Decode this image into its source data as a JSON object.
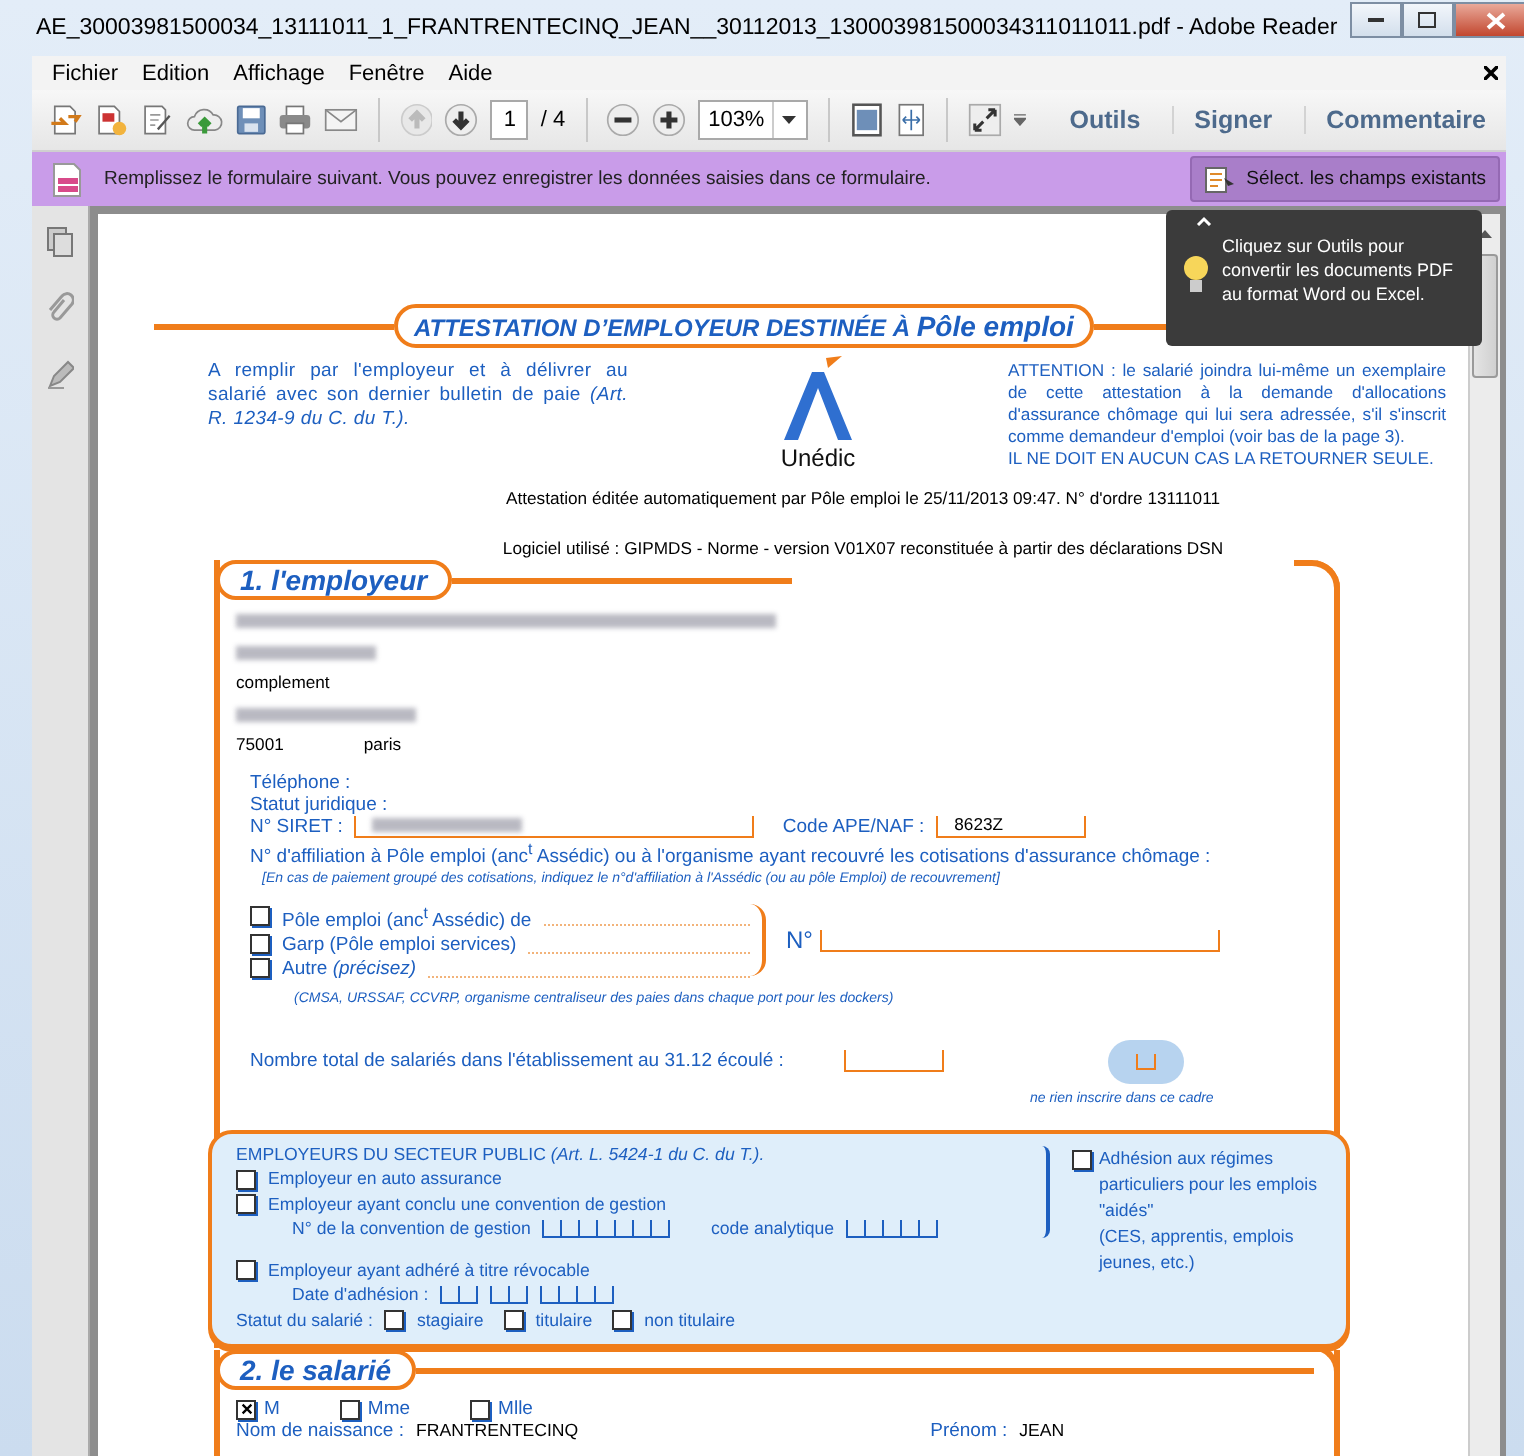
{
  "window": {
    "title": "AE_30003981500034_13111011_1_FRANTRENTECINQ_JEAN__30112013_130003981500034311011011.pdf - Adobe Reader"
  },
  "menu": [
    "Fichier",
    "Edition",
    "Affichage",
    "Fenêtre",
    "Aide"
  ],
  "toolbar": {
    "page": "1",
    "page_total": "/ 4",
    "zoom": "103%",
    "buttons": [
      "Outils",
      "Signer",
      "Commentaire"
    ]
  },
  "form_bar": {
    "message": "Remplissez le formulaire suivant. Vous pouvez enregistrer les données saisies dans ce formulaire.",
    "button": "Sélect. les champs existants"
  },
  "tooltip": {
    "text": "Cliquez sur Outils pour convertir les documents PDF au format Word ou Excel."
  },
  "document": {
    "title": "ATTESTATION D’EMPLOYEUR DESTINÉE À **Pôle emploi**",
    "intro_left": "A remplir par l'employeur et à délivrer au salarié avec son dernier bulletin de paie *(Art. R. 1234-9 du C. du T.).*",
    "logo_text": "Unédic",
    "intro_right": "ATTENTION : le salarié joindra lui-même un exemplaire de cette attestation à la demande d'allocations d'assurance chômage qui lui sera adressée, s'il s'inscrit comme demandeur d'emploi (voir bas de la page 3).",
    "warning": "IL NE DOIT EN AUCUN CAS LA RETOURNER SEULE.",
    "edited_line": "Attestation éditée automatiquement par Pôle emploi le 25/11/2013 09:47. N° d'ordre 13111011",
    "software_line": "Logiciel utilisé : GIPMDS - Norme - version V01X07 reconstituée à partir des déclarations DSN",
    "employer": {
      "heading": "1. l'employeur",
      "lines": [
        {
          "kind": "redacted"
        },
        {
          "kind": "redacted"
        },
        {
          "kind": "text",
          "text": "complement"
        },
        {
          "kind": "redacted"
        }
      ],
      "postcode": "75001",
      "city": "paris",
      "phone_label": "Téléphone :",
      "status_label": "Statut juridique :",
      "siret_label": "N° SIRET :",
      "ape_label": "Code APE/NAF :",
      "ape_value": "8623Z",
      "affiliation_label": "N° d'affiliation à Pôle emploi (anc$^{t}$ Assédic) ou à l'organisme ayant recouvré les cotisations d'assurance chômage :",
      "affiliation_note": "[En cas de paiement groupé des cotisations, indiquez le n°d'affiliation à l'Assédic (ou au pôle Emploi) de recouvrement]",
      "organisms": [
        {
          "label": "Pôle emploi (anc$^{t}$ Assédic) de",
          "checked": false
        },
        {
          "label": "Garp (Pôle emploi services)",
          "checked": false
        },
        {
          "label": "Autre *(précisez)*",
          "checked": false
        }
      ],
      "number_label": "N°",
      "organisms_note": "(CMSA, URSSAF, CCVRP, organisme centraliseur des paies dans chaque port pour les dockers)",
      "headcount_label": "Nombre total de salariés dans l'établissement au 31.12 écoulé :",
      "reserved_note": "ne rien inscrire dans ce cadre"
    },
    "public_sector": {
      "heading": "EMPLOYEURS DU SECTEUR PUBLIC *(Art. L. 5424-1 du C. du T.).*",
      "options": [
        {
          "label": "Employeur en auto assurance",
          "checked": false
        },
        {
          "label": "Employeur ayant conclu une convention de gestion",
          "checked": false
        }
      ],
      "convention_label": "N° de la convention de gestion",
      "code_label": "code analytique",
      "revocable": {
        "label": "Employeur ayant adhéré à titre révocable",
        "checked": false
      },
      "date_label": "Date d'adhésion :",
      "status_label": "Statut du salarié :",
      "statuses": [
        {
          "label": "stagiaire",
          "checked": false
        },
        {
          "label": "titulaire",
          "checked": false
        },
        {
          "label": "non titulaire",
          "checked": false
        }
      ],
      "special": {
        "label": "Adhésion aux régimes particuliers pour les emplois \"aidés\"",
        "note": "(CES, apprentis, emplois jeunes, etc.)",
        "checked": false
      }
    },
    "employee": {
      "heading": "2. le salarié",
      "civilities": [
        {
          "label": "M",
          "checked": true
        },
        {
          "label": "Mme",
          "checked": false
        },
        {
          "label": "Mlle",
          "checked": false
        }
      ],
      "birth_name_label": "Nom de naissance :",
      "birth_name": "FRANTRENTECINQ",
      "first_name_label": "Prénom :",
      "first_name": "JEAN"
    }
  }
}
